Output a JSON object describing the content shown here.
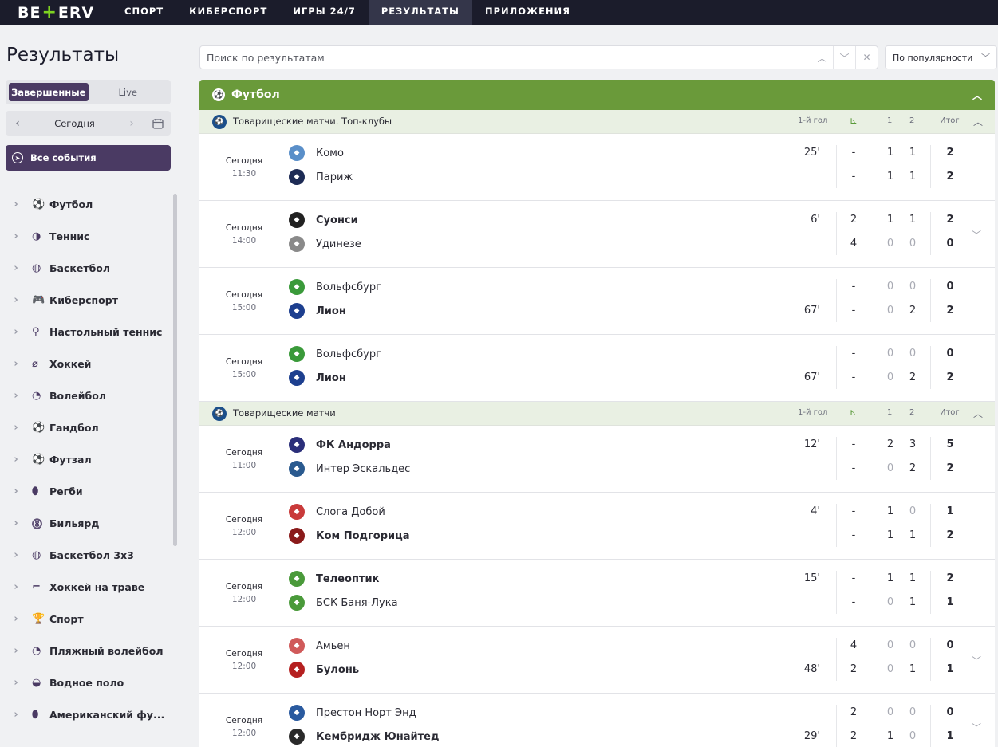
{
  "brand": {
    "logo_left": "BE",
    "logo_plus": "+",
    "logo_right": "ERV"
  },
  "nav": [
    {
      "label": "СПОРТ",
      "active": false
    },
    {
      "label": "КИБЕРСПОРТ",
      "active": false
    },
    {
      "label": "ИГРЫ 24/7",
      "active": false
    },
    {
      "label": "РЕЗУЛЬТАТЫ",
      "active": true
    },
    {
      "label": "ПРИЛОЖЕНИЯ",
      "active": false
    }
  ],
  "sidebar": {
    "title": "Результаты",
    "toggle": {
      "finished": "Завершенные",
      "live": "Live"
    },
    "date": "Сегодня",
    "all_events": "Все события",
    "sports": [
      {
        "label": "Футбол",
        "icon": "⚽"
      },
      {
        "label": "Теннис",
        "icon": "◑"
      },
      {
        "label": "Баскетбол",
        "icon": "◍"
      },
      {
        "label": "Киберспорт",
        "icon": "🎮"
      },
      {
        "label": "Настольный теннис",
        "icon": "⚲"
      },
      {
        "label": "Хоккей",
        "icon": "⌀"
      },
      {
        "label": "Волейбол",
        "icon": "◔"
      },
      {
        "label": "Гандбол",
        "icon": "⚽"
      },
      {
        "label": "Футзал",
        "icon": "⚽"
      },
      {
        "label": "Регби",
        "icon": "⬮"
      },
      {
        "label": "Бильярд",
        "icon": "⓼"
      },
      {
        "label": "Баскетбол 3х3",
        "icon": "◍"
      },
      {
        "label": "Хоккей на траве",
        "icon": "⌐"
      },
      {
        "label": "Спорт",
        "icon": "🏆"
      },
      {
        "label": "Пляжный волейбол",
        "icon": "◔"
      },
      {
        "label": "Водное поло",
        "icon": "◒"
      },
      {
        "label": "Американский фу...",
        "icon": "⬮"
      }
    ]
  },
  "search": {
    "placeholder": "Поиск по результатам",
    "sort": "По популярности"
  },
  "section": {
    "sport": "Футбол"
  },
  "headers": {
    "first_goal": "1-й гол",
    "h1": "1",
    "h2": "2",
    "total": "Итог"
  },
  "leagues": [
    {
      "name": "Товарищеские матчи. Топ-клубы",
      "matches": [
        {
          "date": "Сегодня",
          "time": "11:30",
          "home": "Комо",
          "away": "Париж",
          "home_win": false,
          "away_win": false,
          "min_home": "25'",
          "min_away": "",
          "c": [
            "-",
            "-"
          ],
          "p1": [
            "1",
            "1"
          ],
          "p2": [
            "1",
            "1"
          ],
          "tot": [
            "2",
            "2"
          ],
          "expand": false,
          "home_color": "#5a8fc9",
          "away_color": "#1d2b55"
        },
        {
          "date": "Сегодня",
          "time": "14:00",
          "home": "Суонси",
          "away": "Удинезе",
          "home_win": true,
          "away_win": false,
          "min_home": "6'",
          "min_away": "",
          "c": [
            "2",
            "4"
          ],
          "p1": [
            "1",
            "0"
          ],
          "p2": [
            "1",
            "0"
          ],
          "tot": [
            "2",
            "0"
          ],
          "expand": true,
          "home_color": "#222222",
          "away_color": "#8a8a8a"
        },
        {
          "date": "Сегодня",
          "time": "15:00",
          "home": "Вольфсбург",
          "away": "Лион",
          "home_win": false,
          "away_win": true,
          "min_home": "",
          "min_away": "67'",
          "c": [
            "-",
            "-"
          ],
          "p1": [
            "0",
            "0"
          ],
          "p2": [
            "0",
            "2"
          ],
          "tot": [
            "0",
            "2"
          ],
          "expand": false,
          "home_color": "#3a9a3a",
          "away_color": "#1d3f8f"
        },
        {
          "date": "Сегодня",
          "time": "15:00",
          "home": "Вольфсбург",
          "away": "Лион",
          "home_win": false,
          "away_win": true,
          "min_home": "",
          "min_away": "67'",
          "c": [
            "-",
            "-"
          ],
          "p1": [
            "0",
            "0"
          ],
          "p2": [
            "0",
            "2"
          ],
          "tot": [
            "0",
            "2"
          ],
          "expand": false,
          "home_color": "#3a9a3a",
          "away_color": "#1d3f8f"
        }
      ]
    },
    {
      "name": "Товарищеские матчи",
      "matches": [
        {
          "date": "Сегодня",
          "time": "11:00",
          "home": "ФК Андорра",
          "away": "Интер Эскальдес",
          "home_win": true,
          "away_win": false,
          "min_home": "12'",
          "min_away": "",
          "c": [
            "-",
            "-"
          ],
          "p1": [
            "2",
            "0"
          ],
          "p2": [
            "3",
            "2"
          ],
          "tot": [
            "5",
            "2"
          ],
          "expand": false,
          "home_color": "#2b2f7a",
          "away_color": "#2a5a8f"
        },
        {
          "date": "Сегодня",
          "time": "12:00",
          "home": "Слога Добой",
          "away": "Ком Подгорица",
          "home_win": false,
          "away_win": true,
          "min_home": "4'",
          "min_away": "",
          "c": [
            "-",
            "-"
          ],
          "p1": [
            "1",
            "1"
          ],
          "p2": [
            "0",
            "1"
          ],
          "tot": [
            "1",
            "2"
          ],
          "expand": false,
          "home_color": "#c93a3a",
          "away_color": "#8a1a1a"
        },
        {
          "date": "Сегодня",
          "time": "12:00",
          "home": "Телеоптик",
          "away": "БСК Баня-Лука",
          "home_win": true,
          "away_win": false,
          "min_home": "15'",
          "min_away": "",
          "c": [
            "-",
            "-"
          ],
          "p1": [
            "1",
            "0"
          ],
          "p2": [
            "1",
            "1"
          ],
          "tot": [
            "2",
            "1"
          ],
          "expand": false,
          "home_color": "#4a9a3a",
          "away_color": "#4a9a3a"
        },
        {
          "date": "Сегодня",
          "time": "12:00",
          "home": "Амьен",
          "away": "Булонь",
          "home_win": false,
          "away_win": true,
          "min_home": "",
          "min_away": "48'",
          "c": [
            "4",
            "2"
          ],
          "p1": [
            "0",
            "0"
          ],
          "p2": [
            "0",
            "1"
          ],
          "tot": [
            "0",
            "1"
          ],
          "expand": true,
          "home_color": "#d05a5a",
          "away_color": "#b52020"
        },
        {
          "date": "Сегодня",
          "time": "12:00",
          "home": "Престон Норт Энд",
          "away": "Кембридж Юнайтед",
          "home_win": false,
          "away_win": true,
          "min_home": "",
          "min_away": "29'",
          "c": [
            "2",
            "2"
          ],
          "p1": [
            "0",
            "1"
          ],
          "p2": [
            "0",
            "0"
          ],
          "tot": [
            "0",
            "1"
          ],
          "expand": true,
          "home_color": "#2a5a9f",
          "away_color": "#2a2a2a"
        }
      ]
    }
  ]
}
